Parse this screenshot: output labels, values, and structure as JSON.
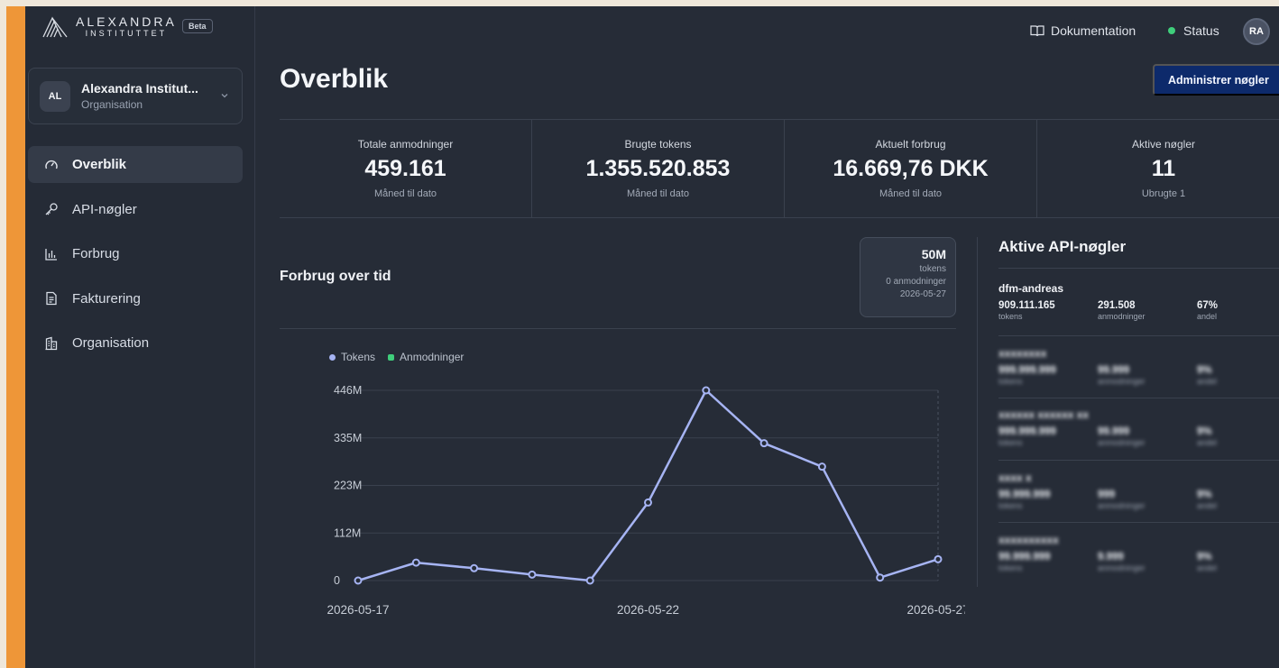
{
  "brand": {
    "name": "ALEXANDRA",
    "sub": "INSTITUTTET",
    "badge": "Beta"
  },
  "organization": {
    "initials": "AL",
    "name": "Alexandra Institut...",
    "type": "Organisation"
  },
  "nav": [
    {
      "label": "Overblik",
      "icon": "dashboard-gauge-icon",
      "active": true
    },
    {
      "label": "API-nøgler",
      "icon": "key-icon",
      "active": false
    },
    {
      "label": "Forbrug",
      "icon": "bar-chart-icon",
      "active": false
    },
    {
      "label": "Fakturering",
      "icon": "invoice-icon",
      "active": false
    },
    {
      "label": "Organisation",
      "icon": "building-icon",
      "active": false
    }
  ],
  "header": {
    "docs_label": "Dokumentation",
    "status_label": "Status",
    "user_initials": "RA"
  },
  "page": {
    "title": "Overblik",
    "admin_button": "Administrer nøgler"
  },
  "stats": [
    {
      "label": "Totale anmodninger",
      "value": "459.161",
      "sub": "Måned til dato"
    },
    {
      "label": "Brugte tokens",
      "value": "1.355.520.853",
      "sub": "Måned til dato"
    },
    {
      "label": "Aktuelt forbrug",
      "value": "16.669,76 DKK",
      "sub": "Måned til dato"
    },
    {
      "label": "Aktive nøgler",
      "value": "11",
      "sub": "Ubrugte 1"
    }
  ],
  "chart_section": {
    "title": "Forbrug over tid",
    "tooltip": {
      "value": "50M",
      "unit": "tokens",
      "requests": "0 anmodninger",
      "date": "2026-05-27"
    }
  },
  "chart_data": {
    "type": "line",
    "legend": [
      "Tokens",
      "Anmodninger"
    ],
    "y_ticks": [
      "0",
      "112M",
      "223M",
      "335M",
      "446M"
    ],
    "x_ticks": [
      "2026-05-17",
      "2026-05-22",
      "2026-05-27"
    ],
    "ylim": [
      0,
      446
    ],
    "series": [
      {
        "name": "Tokens",
        "color": "#a6b4f3",
        "x": [
          "2026-05-17",
          "2026-05-18",
          "2026-05-19",
          "2026-05-20",
          "2026-05-21",
          "2026-05-22",
          "2026-05-23",
          "2026-05-24",
          "2026-05-25",
          "2026-05-26",
          "2026-05-27"
        ],
        "values": [
          0,
          42,
          29,
          14,
          0,
          183,
          446,
          322,
          267,
          7,
          50
        ]
      }
    ]
  },
  "keys_panel": {
    "title": "Aktive API-nøgler",
    "keys": [
      {
        "name": "dfm-andreas",
        "tokens": "909.111.165",
        "requests": "291.508",
        "share": "67%",
        "tokens_label": "tokens",
        "requests_label": "anmodninger",
        "share_label": "andel",
        "blurred": false
      },
      {
        "name": "xxxxxxxx",
        "tokens": "999.999.999",
        "requests": "99.999",
        "share": "9%",
        "tokens_label": "tokens",
        "requests_label": "anmodninger",
        "share_label": "andel",
        "blurred": true
      },
      {
        "name": "xxxxxx xxxxxx xx",
        "tokens": "999.999.999",
        "requests": "99.999",
        "share": "9%",
        "tokens_label": "tokens",
        "requests_label": "anmodninger",
        "share_label": "andel",
        "blurred": true
      },
      {
        "name": "xxxx x",
        "tokens": "99.999.999",
        "requests": "999",
        "share": "9%",
        "tokens_label": "tokens",
        "requests_label": "anmodninger",
        "share_label": "andel",
        "blurred": true
      },
      {
        "name": "xxxxxxxxxx",
        "tokens": "99.999.999",
        "requests": "9.999",
        "share": "9%",
        "tokens_label": "tokens",
        "requests_label": "anmodninger",
        "share_label": "andel",
        "blurred": true
      }
    ]
  }
}
